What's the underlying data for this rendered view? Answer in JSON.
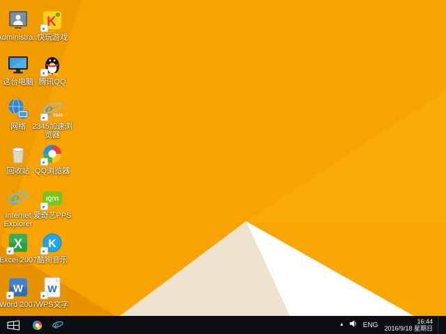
{
  "desktop": {
    "icons": [
      {
        "id": "administrator",
        "label": "Administra..."
      },
      {
        "id": "this-pc",
        "label": "这台电脑"
      },
      {
        "id": "network",
        "label": "网络"
      },
      {
        "id": "recycle-bin",
        "label": "回收站"
      },
      {
        "id": "internet-explorer",
        "label": "Internet Explorer"
      },
      {
        "id": "excel-2007",
        "label": "Excel 2007"
      },
      {
        "id": "word-2007",
        "label": "Word 2007"
      },
      {
        "id": "kuaiwan-games",
        "label": "快玩游戏"
      },
      {
        "id": "tencent-qq",
        "label": "腾讯QQ"
      },
      {
        "id": "2345-browser",
        "label": "2345加速浏览器"
      },
      {
        "id": "qq-browser",
        "label": "QQ浏览器"
      },
      {
        "id": "iqiyi-pps",
        "label": "爱奇艺PPS"
      },
      {
        "id": "kugou-music",
        "label": "酷狗音乐"
      },
      {
        "id": "wps-writer",
        "label": "WPS文字"
      }
    ]
  },
  "taskbar": {
    "tray": {
      "hidden_icons_glyph": "▲",
      "language": "ENG",
      "time": "16:44",
      "date": "2016/9/18 星期日"
    }
  },
  "colors": {
    "wallpaper_base": "#F7A302",
    "wallpaper_facet_dark": "#EE9900",
    "wallpaper_cream": "#EDE3CD",
    "wallpaper_white": "#FFFFFF",
    "taskbar": "#0D0E11",
    "icon_label_text": "#FFFFFF"
  }
}
